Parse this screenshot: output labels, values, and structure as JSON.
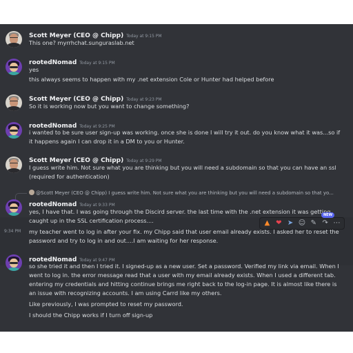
{
  "messages": [
    {
      "author": "Scott Meyer (CEO @ Chipp)",
      "time": "Today at 9:15 PM",
      "lines": [
        "This one? myrrhchat.sunguraslab.net"
      ]
    },
    {
      "author": "rootedNomad",
      "time": "Today at 9:15 PM",
      "lines": [
        "yes",
        "this always seems to happen with my .net extension Cole or Hunter  had helped before"
      ]
    },
    {
      "author": "Scott Meyer (CEO @ Chipp)",
      "time": "Today at 9:23 PM",
      "lines": [
        "So it is working now but you want to change something?"
      ]
    },
    {
      "author": "rootedNomad",
      "time": "Today at 9:25 PM",
      "lines": [
        "i wanted to be sure user sign-up was working. once she is done I will try it out. do you know what it was...so if",
        "it happens again I can drop it in a DM to you or Hunter."
      ]
    },
    {
      "author": "Scott Meyer (CEO @ Chipp)",
      "time": "Today at 9:29 PM",
      "lines": [
        "I guess write him. Not sure what you are thinking but you will need a subdomain so that you can have an ssl",
        "(required for authentication)"
      ]
    },
    {
      "author": "rootedNomad",
      "time": "Today at 9:33 PM",
      "reply": "@Scott Meyer (CEO @ Chipp) I guess write him. Not sure what you are thinking but you will need a subdomain so that yo...",
      "lines": [
        "yes, I have that. I was going through the Discird server. the last time with the .net extension it was getting",
        "caught up in the SSL certification process...."
      ],
      "followup_time": "9:34 PM",
      "followup_lines": [
        "my teacher went to log in after your fix. my Chipp said that user email already exists. I asked her to reset the",
        "password and try to  log in and out....I am waiting for her response."
      ]
    },
    {
      "author": "rootedNomad",
      "time": "Today at 9:47 PM",
      "lines": [
        "so she tried it and then I tried it. I signed-up as a new user. Set a password. Verified my link via email. When I",
        "went to log in. the error message read that a user with my email already exists. When I used a different tab.",
        "entering my credentials and hitting continue brings me right back to the log-in page. It is almost like there is",
        "an issue with recognizing accounts. I am using Carrd like my others.",
        "Like previously, I was prompted to reset my password.",
        "I should the Chipp works if I turn off sign-up"
      ]
    }
  ],
  "toolbar": {
    "new_badge": "NEW",
    "icons": [
      "fire-emoji",
      "heart-emoji",
      "rocket-emoji",
      "add-reaction-icon",
      "edit-icon",
      "reply-icon",
      "more-icon"
    ]
  }
}
